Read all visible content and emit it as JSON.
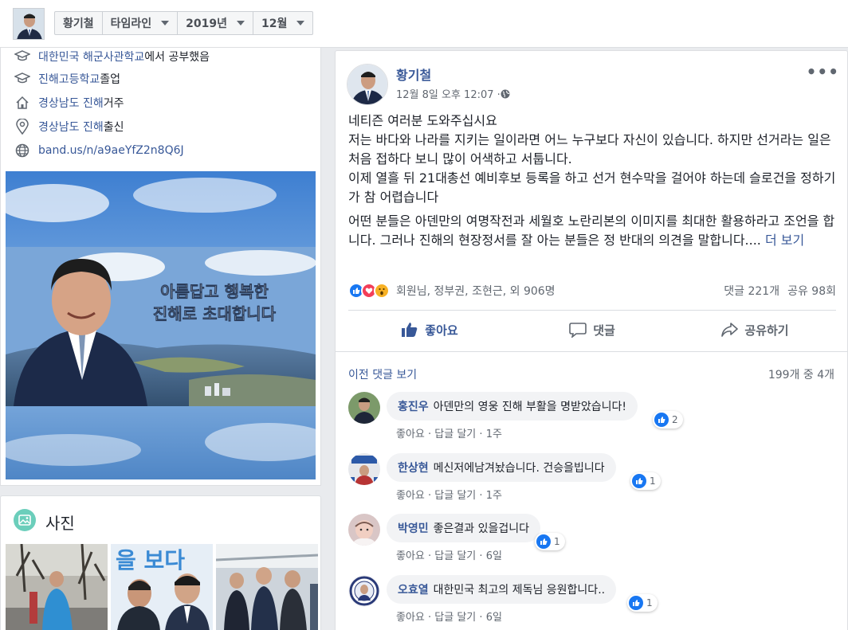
{
  "header": {
    "name": "황기철",
    "view": "타임라인",
    "year": "2019년",
    "month": "12월"
  },
  "intro": {
    "items": [
      {
        "icon": "graduation-cap-icon",
        "link": "대한민국 해군사관학교",
        "text": "에서 공부했음"
      },
      {
        "icon": "graduation-cap-icon",
        "link": "진해고등학교",
        "text": " 졸업"
      },
      {
        "icon": "home-icon",
        "link": "경상남도 진해",
        "text": " 거주"
      },
      {
        "icon": "location-pin-icon",
        "link": "경상남도 진해",
        "text": " 출신"
      },
      {
        "icon": "globe-icon",
        "link": "band.us/n/a9aeYfZ2n8Q6J",
        "text": ""
      }
    ],
    "cover_caption_line1": "아름답고 행복한",
    "cover_caption_line2": "진해로 초대합니다"
  },
  "photos": {
    "title": "사진",
    "thumb2_text": "을 보다"
  },
  "post": {
    "author": "황기철",
    "time": "12월 8일 오후 12:07 · ",
    "paragraph1": "네티즌 여러분 도와주십시요\n저는 바다와 나라를 지키는 일이라면 어느 누구보다 자신이 있습니다. 하지만 선거라는 일은 처음 접하다 보니 많이 어색하고 서툽니다.\n이제 열흘 뒤 21대총선 예비후보 등록을 하고 선거 현수막을 걸어야 하는데 슬로건을 정하기가 참 어렵습니다",
    "paragraph2": "어떤 분들은 아덴만의 여명작전과 세월호 노란리본의 이미지를 최대한 활용하라고 조언을 합니다. 그러나 진해의 현장정서를 잘 아는 분들은 정 반대의 의견을 말합니다.... ",
    "more_label": "더 보기",
    "reactions_text": "회원님, 정부권, 조현근, 외 906명",
    "comments_count": "댓글 221개",
    "shares_count": "공유 98회",
    "like_label": "좋아요",
    "comment_label": "댓글",
    "share_label": "공유하기"
  },
  "comments": {
    "prev_label": "이전 댓글 보기",
    "count_label": "199개 중 4개",
    "items": [
      {
        "name": "홍진우",
        "text": "아덴만의 영웅 진해 부활을 명받았습니다!",
        "likes": "2",
        "like": "좋아요",
        "reply": "답글 달기",
        "age": "1주"
      },
      {
        "name": "한상현",
        "text": "메신저에남겨놨습니다. 건승을빕니다",
        "likes": "1",
        "like": "좋아요",
        "reply": "답글 달기",
        "age": "1주"
      },
      {
        "name": "박영민",
        "text": "좋은결과 있을겁니다",
        "likes": "1",
        "like": "좋아요",
        "reply": "답글 달기",
        "age": "6일"
      },
      {
        "name": "오효열",
        "text": "대한민국 최고의 제독님 응원합니다..",
        "likes": "1",
        "like": "좋아요",
        "reply": "답글 달기",
        "age": "6일"
      }
    ]
  },
  "colors": {
    "link": "#385898",
    "like_blue": "#1877f2",
    "background": "#e9ebee"
  }
}
